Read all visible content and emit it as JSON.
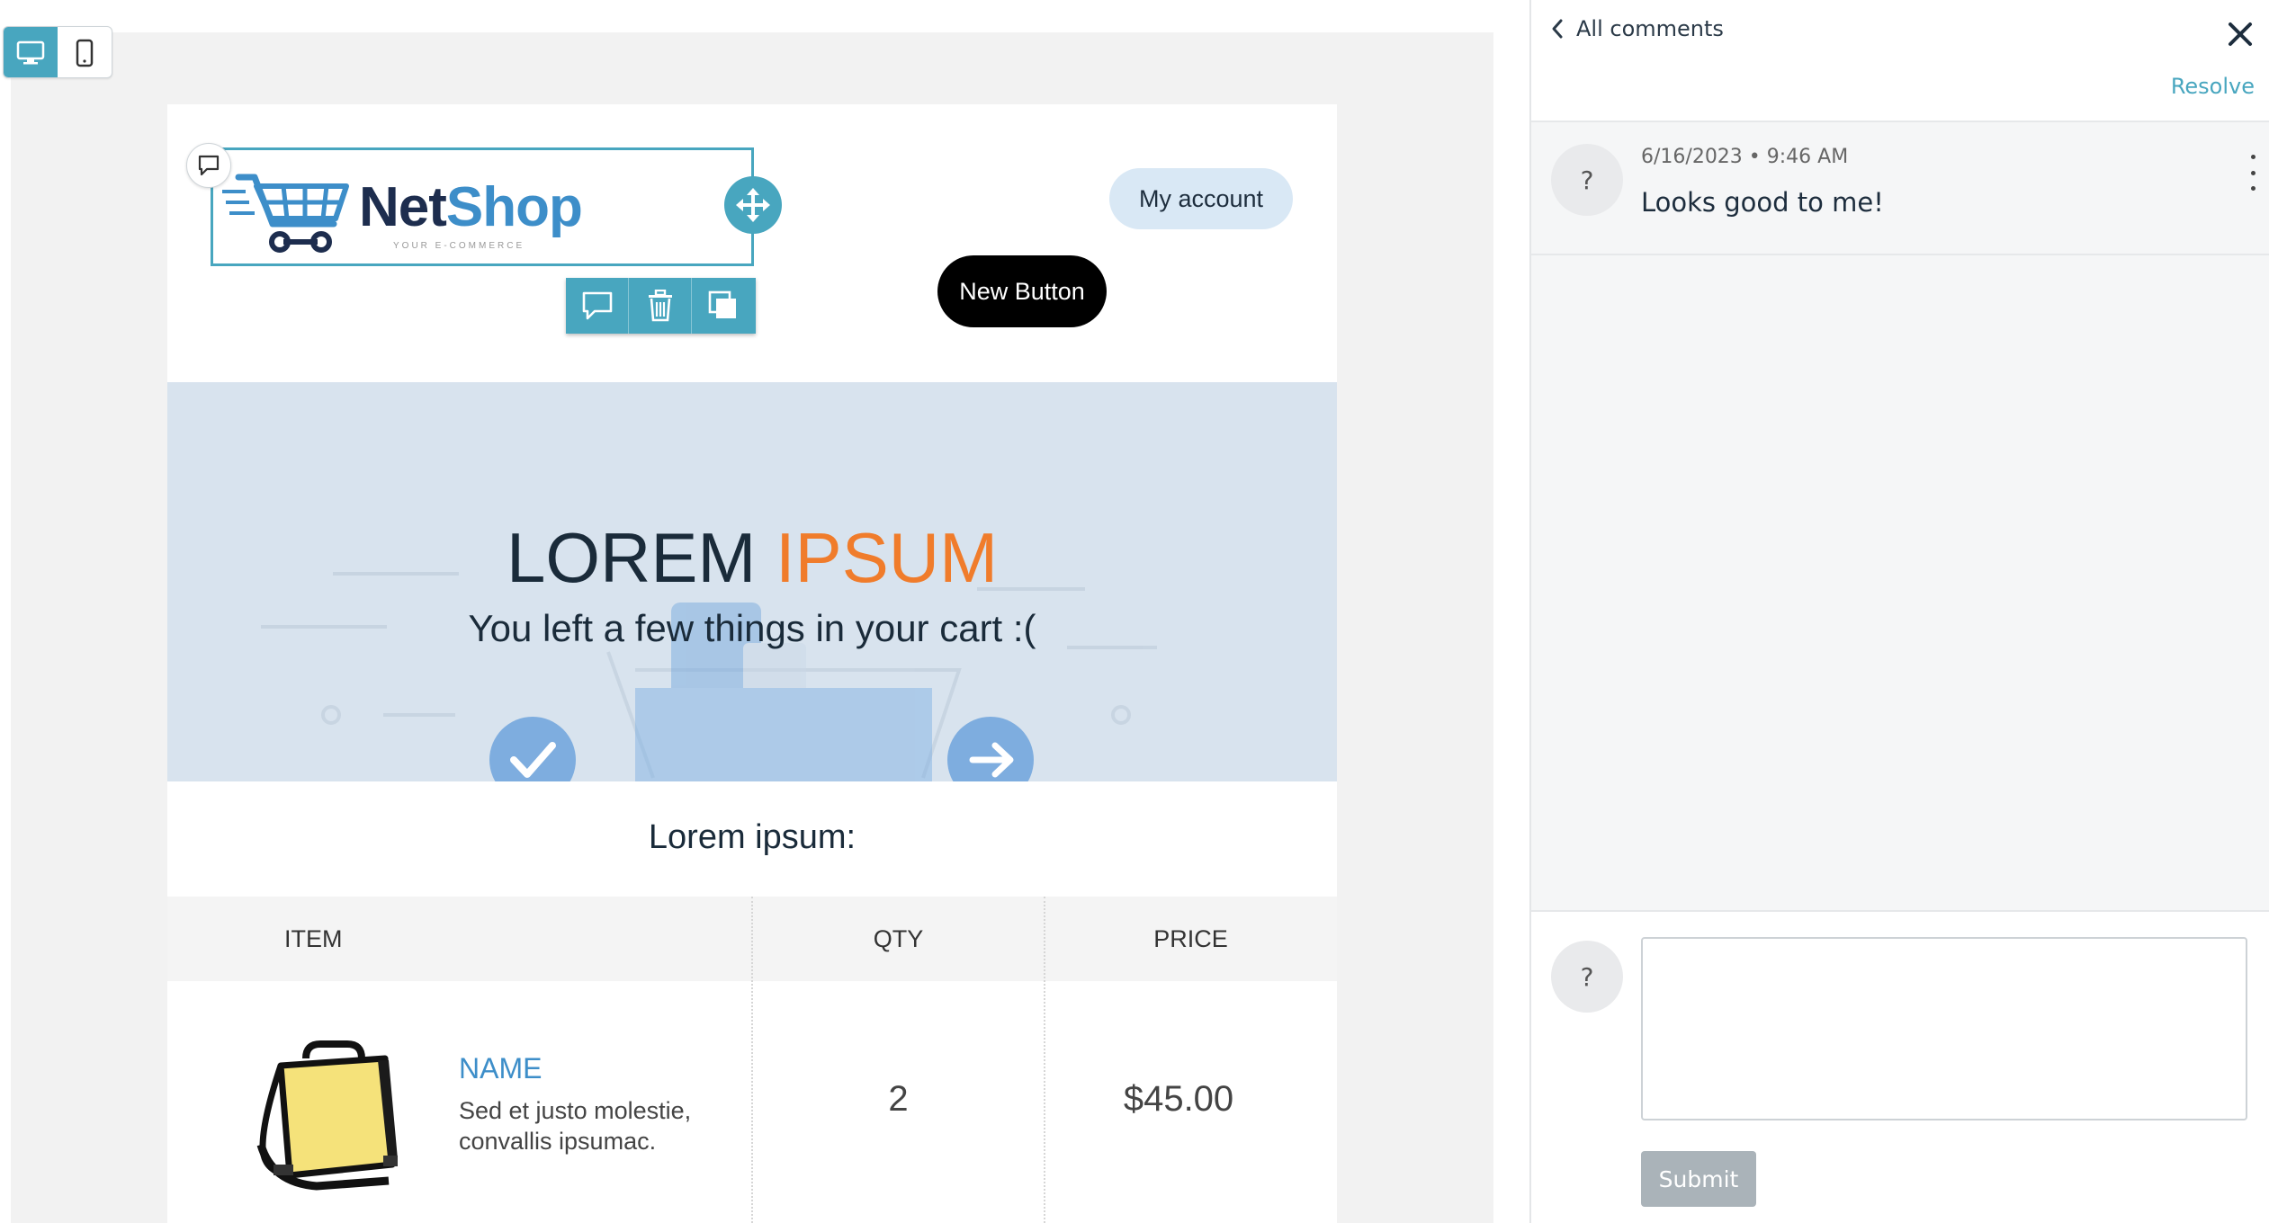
{
  "view_toggle": {
    "desktop_icon": "desktop-icon",
    "mobile_icon": "mobile-icon",
    "active": "desktop"
  },
  "email": {
    "logo": {
      "name_part1": "Net",
      "name_part2": "Shop",
      "tagline": "YOUR E-COMMERCE",
      "brand_dark": "#1d2d4e",
      "brand_blue": "#3d8ec9"
    },
    "header_buttons": {
      "my_account": "My account",
      "new_button": "New Button"
    },
    "block_toolbar": {
      "comment_icon": "comment-icon",
      "delete_icon": "trash-icon",
      "duplicate_icon": "duplicate-icon"
    },
    "hero": {
      "title_part1": "LOREM",
      "title_part2": "IPSUM",
      "subtitle": "You left a few things in your cart :(",
      "accent": "#f07c2b",
      "bg": "#d8e3ee"
    },
    "section_title": "Lorem ipsum:",
    "table": {
      "headers": [
        "ITEM",
        "QTY",
        "PRICE"
      ],
      "rows": [
        {
          "name": "NAME",
          "description": "Sed et justo molestie, convallis ipsumac.",
          "qty": "2",
          "price": "$45.00"
        }
      ]
    }
  },
  "comments_panel": {
    "back_label": "All comments",
    "resolve_label": "Resolve",
    "comments": [
      {
        "avatar": "?",
        "meta": "6/16/2023 • 9:46 AM",
        "text": "Looks good to me!"
      }
    ],
    "reply": {
      "avatar": "?",
      "value": "",
      "submit_label": "Submit"
    },
    "accent": "#48a6bf"
  }
}
